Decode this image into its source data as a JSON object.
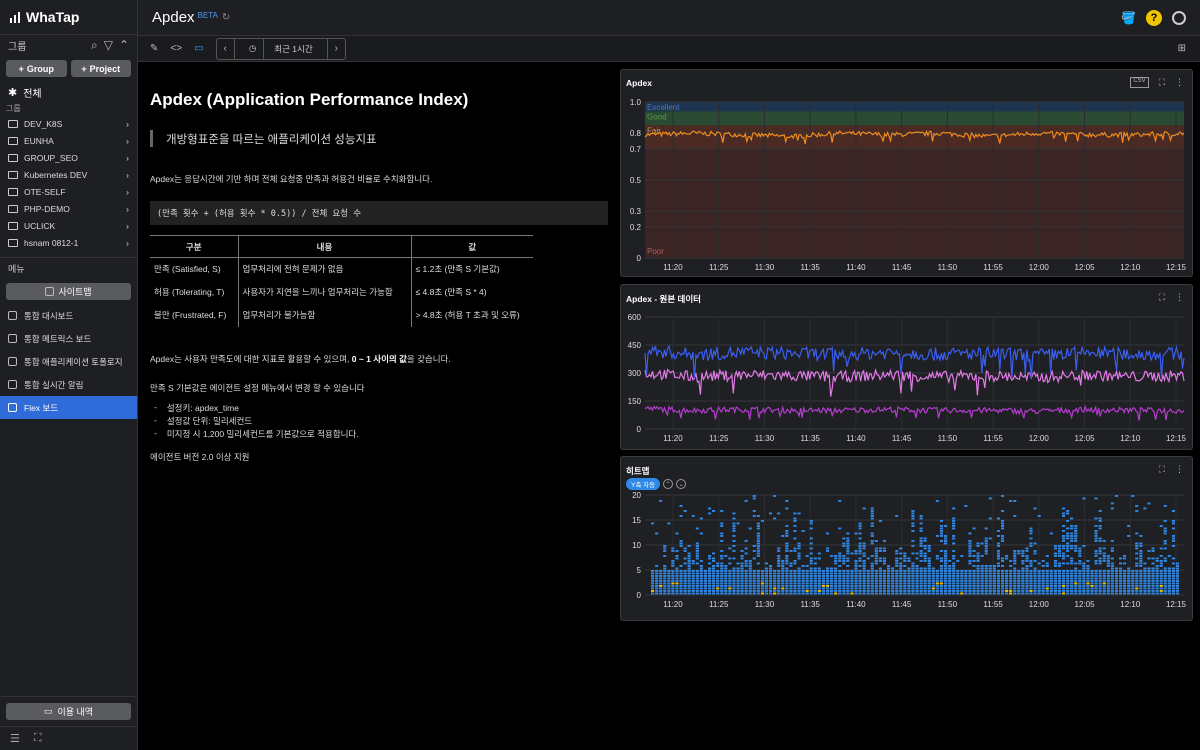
{
  "app": {
    "brand": "WhaTap"
  },
  "sidebar": {
    "group_header": "그룹",
    "add_group": "Group",
    "add_project": "Project",
    "all_label": "전체",
    "sub_label": "그룹",
    "folders": [
      "DEV_K8S",
      "EUNHA",
      "GROUP_SEO",
      "Kubernetes DEV",
      "OTE-SELF",
      "PHP-DEMO",
      "UCLICK",
      "hsnam 0812-1"
    ],
    "menu_header": "메뉴",
    "sitemap": "사이트맵",
    "nav": [
      "통합 대시보드",
      "통합 메트릭스 보드",
      "통합 애플리케이션 토폴로지",
      "통합 실시간 알림",
      "Flex 보드"
    ],
    "usage": "이용 내역"
  },
  "header": {
    "title": "Apdex",
    "badge": "BETA"
  },
  "toolbar": {
    "time_label": "최근 1시간"
  },
  "doc": {
    "title": "Apdex (Application Performance Index)",
    "quote": "개방형표준을 따르는 애플리케이션 성능지표",
    "intro": "Apdex는 응답시간에 기반 하며 전체 요청중 만족과 허용건 비율로 수치화합니다.",
    "formula": "(만족 횟수 + (허용 횟수 * 0.5)) / 전체 요청 수",
    "table_headers": [
      "구분",
      "내용",
      "값"
    ],
    "table_rows": [
      [
        "만족 (Satisfied, S)",
        "업무처리에 전혀 문제가 없음",
        "≤ 1.2초 (만족 S 기본값)"
      ],
      [
        "허용 (Tolerating, T)",
        "사용자가 지연을 느끼나 업무처리는 가능함",
        "≤ 4.8초 (만족 S * 4)"
      ],
      [
        "불만 (Frustrated, F)",
        "업무처리가 불가능함",
        "> 4.8초 (허용 T 초과 및 오류)"
      ]
    ],
    "range_pre": "Apdex는 사용자 만족도에 대한 지표로 활용할 수 있으며, ",
    "range_bold": "0 ~ 1 사이의 값",
    "range_post": "을 갖습니다.",
    "setting_line": "만족 S 기본값은 에이전트 설정 메뉴에서 변경 할 수 있습니다",
    "bullets": [
      "설정키: apdex_time",
      "설정값 단위: 밀리세컨드",
      "미지정 시 1,200 밀리세컨드를 기본값으로 적용합니다."
    ],
    "agent_note": "에이전트 버전 2.0 이상 지원"
  },
  "panels": {
    "apdex_title": "Apdex",
    "raw_title": "Apdex - 원본 데이터",
    "heatmap_title": "히트맵",
    "heatmap_pill": "Y축 자동",
    "apdex_bands": [
      "Excellent",
      "Good",
      "Fair",
      "Poor"
    ],
    "x_ticks": [
      "11:20",
      "11:25",
      "11:30",
      "11:35",
      "11:40",
      "11:45",
      "11:50",
      "11:55",
      "12:00",
      "12:05",
      "12:10",
      "12:15"
    ]
  },
  "chart_data": [
    {
      "type": "line",
      "title": "Apdex",
      "ylim": [
        0,
        1
      ],
      "y_ticks": [
        "1.0",
        "0.8",
        "0.7",
        "0.5",
        "0.3",
        "0.2",
        "0"
      ],
      "x_ticks": [
        "11:20",
        "11:25",
        "11:30",
        "11:35",
        "11:40",
        "11:45",
        "11:50",
        "11:55",
        "12:00",
        "12:05",
        "12:10",
        "12:15"
      ],
      "bands": [
        {
          "label": "Excellent",
          "from": 0.94,
          "to": 1.0
        },
        {
          "label": "Good",
          "from": 0.85,
          "to": 0.94
        },
        {
          "label": "Fair",
          "from": 0.7,
          "to": 0.85
        },
        {
          "label": "Poor",
          "from": 0,
          "to": 0.7
        }
      ],
      "series": [
        {
          "values": [
            0.79,
            0.8,
            0.79,
            0.78,
            0.8,
            0.79,
            0.8,
            0.78,
            0.8,
            0.79,
            0.79,
            0.8
          ]
        }
      ],
      "colors": [
        "#f08a1c"
      ]
    },
    {
      "type": "line",
      "title": "Apdex - 원본 데이터",
      "ylim": [
        0,
        600
      ],
      "y_ticks": [
        "600",
        "450",
        "300",
        "150",
        "0"
      ],
      "x_ticks": [
        "11:20",
        "11:25",
        "11:30",
        "11:35",
        "11:40",
        "11:45",
        "11:50",
        "11:55",
        "12:00",
        "12:05",
        "12:10",
        "12:15"
      ],
      "series": [
        {
          "values": [
            420,
            400,
            410,
            405,
            400,
            410,
            400,
            405,
            395,
            410,
            400,
            405
          ]
        },
        {
          "values": [
            300,
            280,
            290,
            285,
            280,
            290,
            280,
            285,
            275,
            290,
            280,
            285
          ]
        },
        {
          "values": [
            110,
            100,
            105,
            100,
            100,
            105,
            100,
            100,
            95,
            105,
            100,
            100
          ]
        }
      ],
      "colors": [
        "#3a5ff0",
        "#e27ae8",
        "#b43ccf"
      ]
    },
    {
      "type": "heatmap",
      "title": "히트맵",
      "ylim": [
        0,
        20
      ],
      "y_ticks": [
        "20",
        "15",
        "10",
        "5",
        "0"
      ],
      "x_ticks": [
        "11:20",
        "11:25",
        "11:30",
        "11:35",
        "11:40",
        "11:45",
        "11:50",
        "11:55",
        "12:00",
        "12:05",
        "12:10",
        "12:15"
      ],
      "colors": [
        "#2f89e8",
        "#f0c400"
      ]
    }
  ]
}
